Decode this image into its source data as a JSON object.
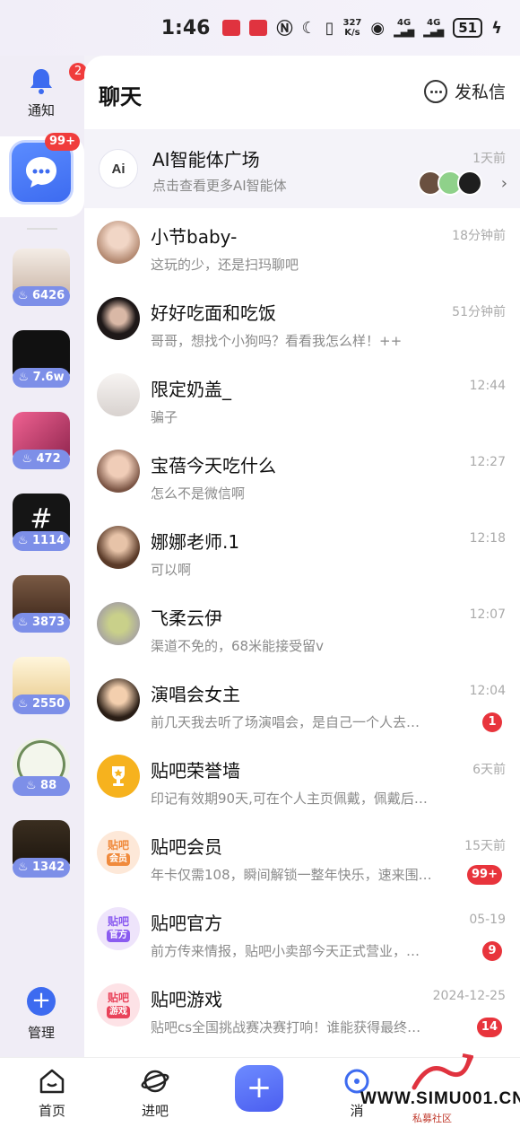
{
  "status_bar": {
    "time": "1:46",
    "net_speed": "327",
    "net_unit": "K/s",
    "signal_1": "4G",
    "signal_2": "4G",
    "battery": "51"
  },
  "sidebar": {
    "notify_label": "通知",
    "notify_count": "2",
    "chat_badge": "99+",
    "bars": [
      {
        "heat": "6426",
        "color": "#d9c7b8"
      },
      {
        "heat": "7.6w",
        "color": "#111111"
      },
      {
        "heat": "472",
        "color": "#d9336f"
      },
      {
        "heat": "1114",
        "color": "#151515"
      },
      {
        "heat": "3873",
        "color": "#5a3a2a"
      },
      {
        "heat": "2550",
        "color": "#f2dca0"
      },
      {
        "heat": "88",
        "color": "#e8efe0"
      },
      {
        "heat": "1342",
        "color": "#2b2218"
      }
    ],
    "manage_label": "管理"
  },
  "header": {
    "title": "聊天",
    "dm_label": "发私信"
  },
  "ai_banner": {
    "title": "AI智能体广场",
    "subtitle": "点击查看更多AI智能体",
    "time": "1天前",
    "icon_text": "Ai"
  },
  "chats": [
    {
      "name": "小节baby-",
      "preview": "这玩的少，还是扫玛聊吧",
      "time": "18分钟前",
      "unread": "",
      "color": "#c9a48e"
    },
    {
      "name": "好好吃面和吃饭",
      "preview": "哥哥，想找个小狗吗？看看我怎么样！++",
      "time": "51分钟前",
      "unread": "",
      "color": "#3a2e2c"
    },
    {
      "name": "限定奶盖_",
      "preview": "骗子",
      "time": "12:44",
      "unread": "",
      "color": "#e9e4e1"
    },
    {
      "name": "宝蓓今天吃什么",
      "preview": "怎么不是微信啊",
      "time": "12:27",
      "unread": "",
      "color": "#a07a62"
    },
    {
      "name": "娜娜老师.1",
      "preview": "可以啊",
      "time": "12:18",
      "unread": "",
      "color": "#7a5a44"
    },
    {
      "name": "飞柔云伊",
      "preview": "渠道不免的，68米能接受留v",
      "time": "12:07",
      "unread": "",
      "color": "#b6b89a"
    },
    {
      "name": "演唱会女主",
      "preview": "前几天我去听了场演唱会，是自己一个人去…",
      "time": "12:04",
      "unread": "1",
      "color": "#b07850"
    },
    {
      "name": "贴吧荣誉墙",
      "preview": "印记有效期90天,可在个人主页佩戴，佩戴后…",
      "time": "6天前",
      "unread": "",
      "color": "#f6b21e"
    },
    {
      "name": "贴吧会员",
      "preview": "年卡仅需108，瞬间解锁一整年快乐，速来围…",
      "time": "15天前",
      "unread": "99+",
      "color": "#fbe9dc"
    },
    {
      "name": "贴吧官方",
      "preview": "前方传来情报，贴吧小卖部今天正式营业，…",
      "time": "05-19",
      "unread": "9",
      "color": "#eee5fb"
    },
    {
      "name": "贴吧游戏",
      "preview": "贴吧cs全国挑战赛决赛打响！谁能获得最终…",
      "time": "2024-12-25",
      "unread": "14",
      "color": "#fde4e8"
    }
  ],
  "tags": {
    "member_top": "贴吧",
    "member_sub": "会员",
    "official_top": "贴吧",
    "official_sub": "官方",
    "game_top": "贴吧",
    "game_sub": "游戏"
  },
  "bottom_nav": {
    "home": "首页",
    "enter_bar": "进吧",
    "messages": "消"
  },
  "watermark": {
    "text": "WWW.SIMU001.CN",
    "sub": "私募社区"
  }
}
